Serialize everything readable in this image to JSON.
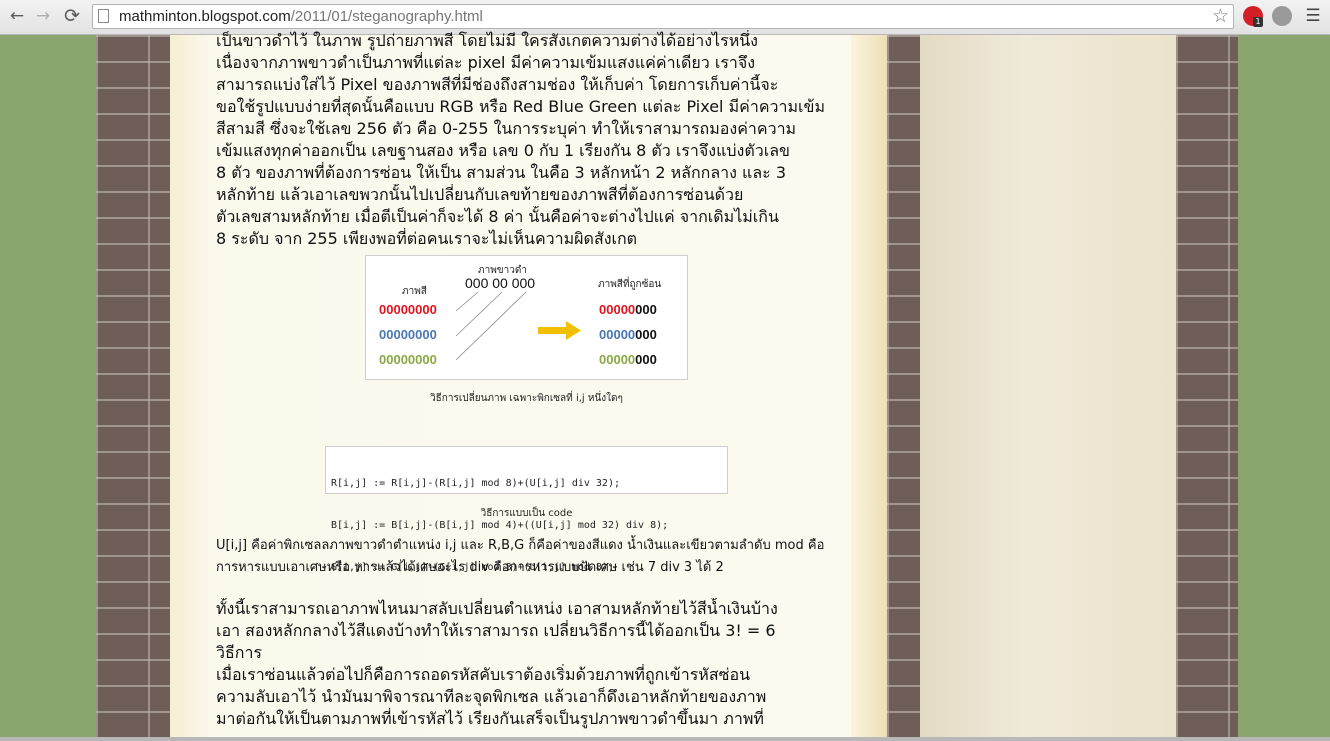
{
  "browser": {
    "url_host": "mathminton.blogspot.com",
    "url_path": "/2011/01/steganography.html",
    "back_icon": "←",
    "forward_icon": "→",
    "reload_icon": "⟳",
    "star_icon": "☆",
    "menu_icon": "☰",
    "extension_badge": "1"
  },
  "article": {
    "intro_lines": [
      "เป็นขาวดำไว้ ในภาพ รูปถ่ายภาพสี  โดยไม่มี ใครสังเกตความต่างได้อย่างไรหนึ่ง",
      "เนื่องจากภาพขาวดำเป็นภาพที่แต่ละ pixel มีค่าความเข้มแสงแค่ค่าเดียว เราจึง",
      "สามารถแบ่งใส่ไว้ Pixel ของภาพสีที่มีช่องถึงสามช่อง ให้เก็บค่า  โดยการเก็บค่านี้จะ",
      "ขอใช้รูปแบบง่ายที่สุดนั้นคือแบบ RGB หรือ Red Blue Green แต่ละ Pixel มีค่าความเข้ม",
      "สีสามสี ซึ่งจะใช้เลข 256 ตัว คือ 0-255 ในการระบุค่า ทำให้เราสามารถมองค่าความ",
      "เข้มแสงทุกค่าออกเป็น เลขฐานสอง หรือ เลข 0 กับ 1 เรียงกัน 8 ตัว เราจึงแบ่งตัวเลข",
      "8 ตัว ของภาพที่ต้องการซ่อน ให้เป็น สามส่วน  ในคือ 3 หลักหน้า 2 หลักกลาง และ 3",
      "หลักท้าย แล้วเอาเลขพวกนั้นไปเปลี่ยนกับเลขท้ายของภาพสีที่ต้องการซ่อนด้วย",
      "ตัวเลขสามหลักท้าย เมื่อตีเป็นค่าก็จะได้ 8 ค่า  นั้นคือค่าจะต่างไปแค่ จากเดิมไม่เกิน",
      "8 ระดับ จาก 255 เพียงพอที่ต่อคนเราจะไม่เห็นความผิดสังเกต"
    ],
    "figure": {
      "label_color": "ภาพสี",
      "label_bw": "ภาพขาวดำ",
      "bw_value": "000 00 000",
      "label_hidden": "ภาพสีที่ถูกซ้อน",
      "left_values": [
        "00000000",
        "00000000",
        "00000000"
      ],
      "right_prefixes": [
        "00000",
        "00000",
        "00000"
      ],
      "right_suffixes": [
        "000",
        "000",
        "000"
      ],
      "colors": {
        "red": "#e0141e",
        "blue": "#4a78b4",
        "green": "#8aa844",
        "arrow": "#f0c000",
        "black": "#111111"
      }
    },
    "figure_caption": "วิธีการเปลี่ยนภาพ เฉพาะพิกเซลที่ i,j หนึ่งใดๆ",
    "code_lines": [
      "R[i,j] := R[i,j]-(R[i,j] mod 8)+(U[i,j] div 32);",
      "B[i,j] := B[i,j]-(B[i,j] mod 4)+((U[i,j] mod 32) div 8);",
      "G[i,j] := G[i,j]-(G[i,j] mod 8)+(U[i,j] mod 8);"
    ],
    "code_caption": "วิธีการแบบเป็น code",
    "explain_lines": [
      "U[i,j] คือค่าพิกเซลลภาพขาวดำตำแหน่ง i,j และ R,B,G ก็คือค่าของสีแดง น้ำเงินและเขียวตามลำดับ mod คือ",
      "การหารแบบเอาเศษหรือ หารแล้วได้เศษอะไร div คือการหารแบบปัดเศษ เช่น 7 div 3 ได้ 2"
    ],
    "outro_lines": [
      "ทั้งนี้เราสามารถเอาภาพไหนมาสลับเปลี่ยนตำแหน่ง เอาสามหลักท้ายไว้สีน้ำเงินบ้าง",
      "เอา สองหลักกลางไว้สีแดงบ้างทำให้เราสามารถ เปลี่ยนวิธีการนี้ได้ออกเป็น 3! = 6",
      "วิธีการ",
      "เมื่อเราซ่อนแล้วต่อไปก็คือการถอดรหัสคับเราต้องเริ่มด้วยภาพที่ถูกเข้ารหัสซ่อน",
      "ความลับเอาไว้ นำมันมาพิจารณาทีละจุดพิกเซล แล้วเอาก็ดึงเอาหลักท้ายของภาพ",
      "มาต่อกันให้เป็นตามภาพที่เข้ารหัสไว้ เรียงกันเสร็จเป็นรูปภาพขาวดำขึ้นมา ภาพที่"
    ]
  }
}
